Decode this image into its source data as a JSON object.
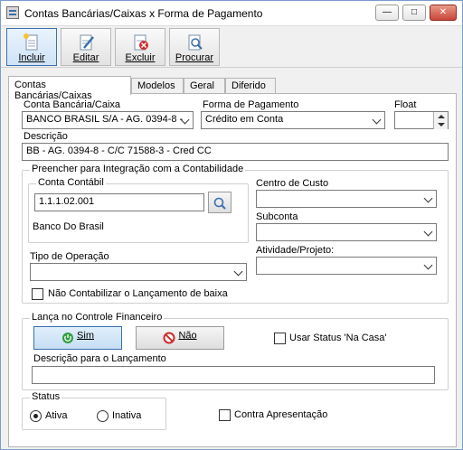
{
  "window": {
    "title": "Contas Bancárias/Caixas x Forma de Pagamento"
  },
  "toolbar": {
    "incluir": "Incluir",
    "editar": "Editar",
    "excluir": "Excluir",
    "procurar": "Procurar"
  },
  "tabs": [
    {
      "label": "Contas Bancárias/Caixas",
      "active": true
    },
    {
      "label": "Modelos"
    },
    {
      "label": "Geral"
    },
    {
      "label": "Diferido"
    }
  ],
  "form": {
    "conta_label": "Conta Bancária/Caixa",
    "conta_value": "BANCO BRASIL S/A - AG. 0394-8 -",
    "forma_label": "Forma de Pagamento",
    "forma_value": "Crédito em Conta",
    "float_label": "Float",
    "float_value": "",
    "descricao_label": "Descrição",
    "descricao_value": "BB - AG. 0394-8 - C/C 71588-3 - Cred CC"
  },
  "contabilidade": {
    "group_title": "Preencher para Integração com a Contabilidade",
    "conta_contabil_label": "Conta Contábil",
    "conta_contabil_value": "1.1.1.02.001",
    "conta_contabil_desc": "Banco Do Brasil",
    "centro_custo_label": "Centro de Custo",
    "subconta_label": "Subconta",
    "tipo_operacao_label": "Tipo de Operação",
    "atividade_label": "Atividade/Projeto:",
    "nao_contabilizar_label": "Não Contabilizar o Lançamento de baixa"
  },
  "financeiro": {
    "group_title": "Lança no Controle Financeiro",
    "sim_label": "Sim",
    "nao_label": "Não",
    "usar_status_label": "Usar Status 'Na Casa'",
    "descricao_lancamento_label": "Descrição para o Lançamento",
    "descricao_lancamento_value": ""
  },
  "status": {
    "group_title": "Status",
    "ativa_label": "Ativa",
    "inativa_label": "Inativa",
    "selected": "Ativa",
    "contra_apresentacao_label": "Contra Apresentação"
  },
  "colors": {
    "accent": "#3a6fb0",
    "sim_icon": "#2e9e3c",
    "nao_icon": "#d12b2b"
  },
  "icons": {
    "incluir": "new-document-icon",
    "editar": "edit-icon",
    "excluir": "delete-icon",
    "procurar": "search-icon"
  }
}
